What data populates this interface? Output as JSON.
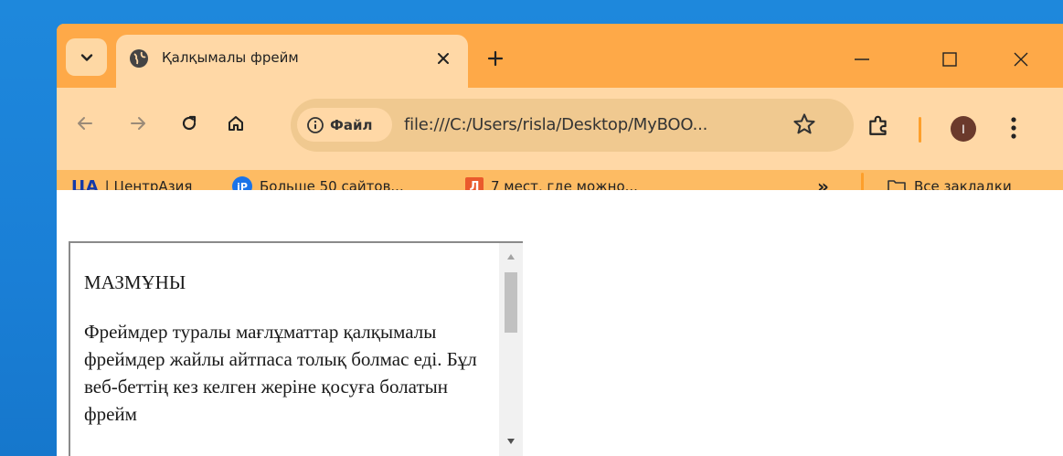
{
  "tab": {
    "title": "Қалқымалы фрейм",
    "favicon": "globe-icon"
  },
  "window_controls": [
    "minimize-icon",
    "maximize-icon",
    "close-icon"
  ],
  "toolbar": {
    "site_info_label": "Файл",
    "url": "file:///C:/Users/risla/Desktop/MyBOO...",
    "avatar_letter": "I"
  },
  "bookmarks": {
    "items": [
      {
        "icon_text": "ЦА",
        "label": "| ЦентрАзия"
      },
      {
        "icon_text": "iP",
        "label": "Больше 50 сайтов..."
      },
      {
        "icon_text": "Л",
        "label": "7 мест, где можно..."
      }
    ],
    "overflow": "»",
    "all_bookmarks_label": "Все закладки"
  },
  "iframe": {
    "heading": "МАЗМҰНЫ",
    "paragraph": "Фреймдер туралы мағлұматтар қалқымалы фреймдер жайлы айтпаса толық болмас еді. Бұл веб-беттің кез келген жеріне қосуға болатын фрейм"
  },
  "colors": {
    "tabstrip": "#fea948",
    "toolbar": "#ffd8a6",
    "accent": "#fd9f2b",
    "desktop": "#1a7fd6"
  }
}
